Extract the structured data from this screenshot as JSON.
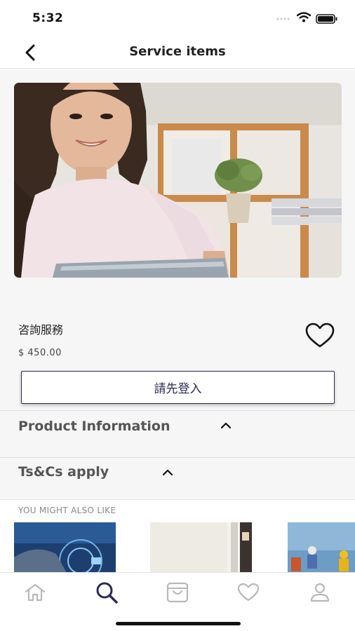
{
  "status_bar": {
    "time": "5:32"
  },
  "nav": {
    "title": "Service items"
  },
  "product": {
    "name": "咨詢服務",
    "price": "$ 450.00"
  },
  "login_button": {
    "label": "請先登入"
  },
  "sections": [
    {
      "label": "Product Information"
    },
    {
      "label": "Ts&Cs apply"
    }
  ],
  "suggestions": {
    "title": "YOU MIGHT ALSO LIKE"
  },
  "tabs": [
    {
      "icon": "home-icon",
      "active": false
    },
    {
      "icon": "search-icon",
      "active": true
    },
    {
      "icon": "cart-icon",
      "active": false
    },
    {
      "icon": "heart-icon",
      "active": false
    },
    {
      "icon": "profile-icon",
      "active": false
    }
  ],
  "colors": {
    "accent": "#2b2a55",
    "inactive_tab": "#b8b8b8",
    "section_text": "#555555"
  }
}
